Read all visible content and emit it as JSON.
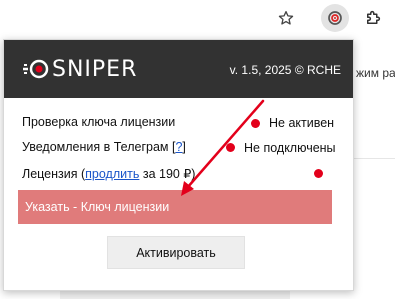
{
  "popup": {
    "logo_text": "SNIPER",
    "version": "v. 1.5, 2025 © RCHE",
    "rows": {
      "license_check": {
        "label": "Проверка ключа лицензии",
        "status": "Не активен"
      },
      "telegram": {
        "label_before": "Уведомления в Телеграм [",
        "help_link": "?",
        "label_after": "]",
        "status": "Не подключены"
      },
      "license": {
        "label_before": "Лецензия (",
        "buy_link": "продлить",
        "label_after": " за 190 ₽)"
      }
    },
    "key_input": {
      "placeholder": "Указать - Ключ лицензии",
      "value": ""
    },
    "activate_label": "Активировать"
  },
  "background": {
    "partial_text": "жим ра"
  },
  "colors": {
    "header_bg": "#323232",
    "status_dot": "#e3001b",
    "input_bg": "#e07b7b",
    "arrow": "#e3001b",
    "link": "#1a55c9"
  },
  "icons": [
    "star-icon",
    "sniper-extension-icon",
    "puzzle-icon",
    "sniper-logo-icon"
  ]
}
